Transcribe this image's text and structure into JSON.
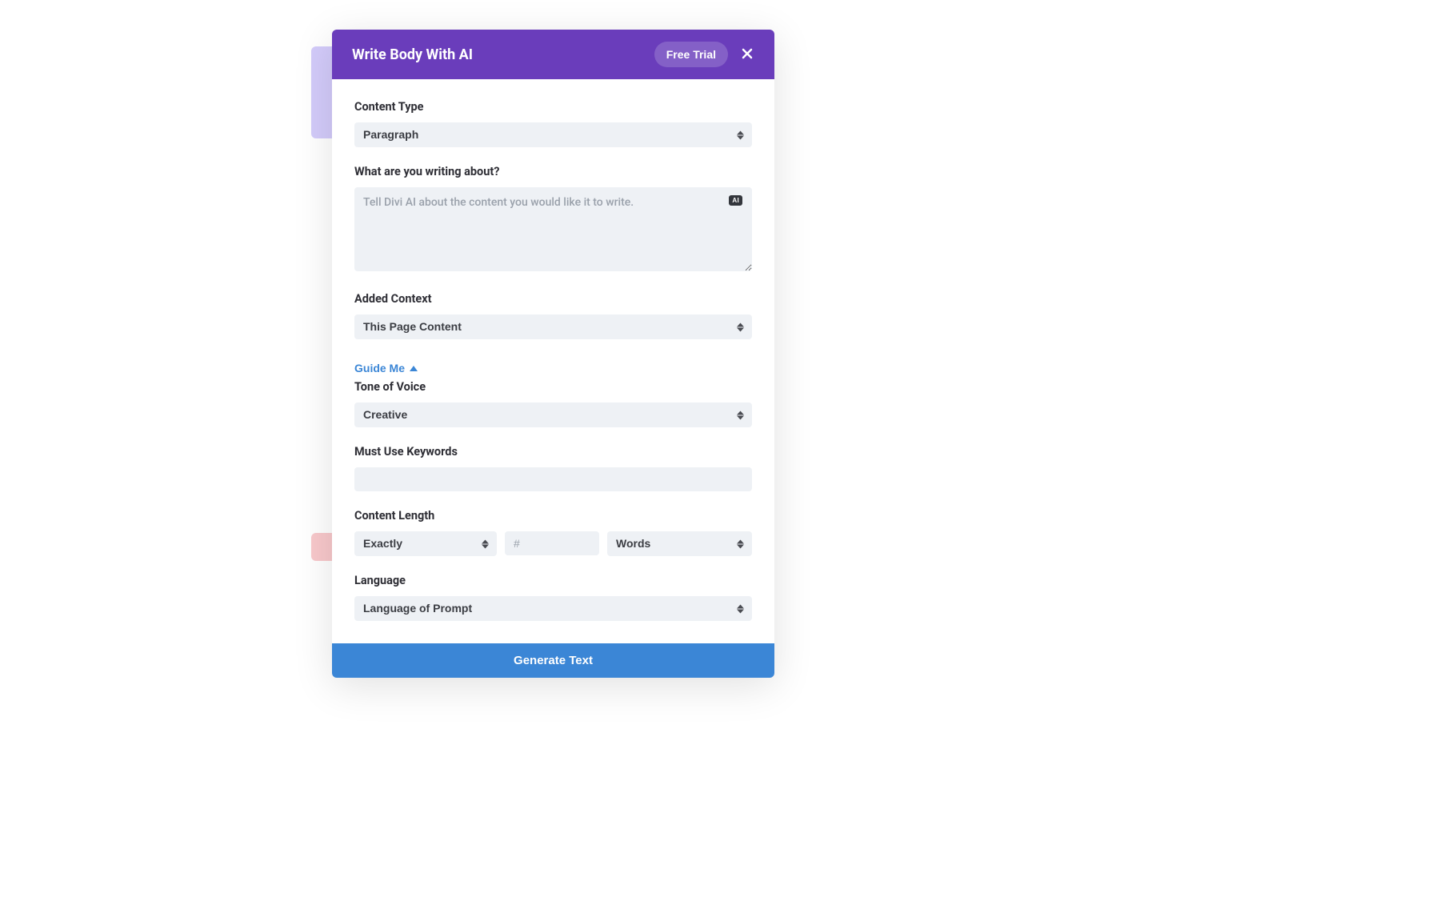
{
  "header": {
    "title": "Write Body With AI",
    "free_trial": "Free Trial"
  },
  "form": {
    "content_type": {
      "label": "Content Type",
      "value": "Paragraph"
    },
    "writing_about": {
      "label": "What are you writing about?",
      "placeholder": "Tell Divi AI about the content you would like it to write.",
      "ai_badge": "AI"
    },
    "added_context": {
      "label": "Added Context",
      "value": "This Page Content"
    },
    "guide_me": "Guide Me",
    "tone": {
      "label": "Tone of Voice",
      "value": "Creative"
    },
    "keywords": {
      "label": "Must Use Keywords",
      "value": ""
    },
    "content_length": {
      "label": "Content Length",
      "mode": "Exactly",
      "count_placeholder": "#",
      "unit": "Words"
    },
    "language": {
      "label": "Language",
      "value": "Language of Prompt"
    }
  },
  "footer": {
    "generate": "Generate Text"
  }
}
